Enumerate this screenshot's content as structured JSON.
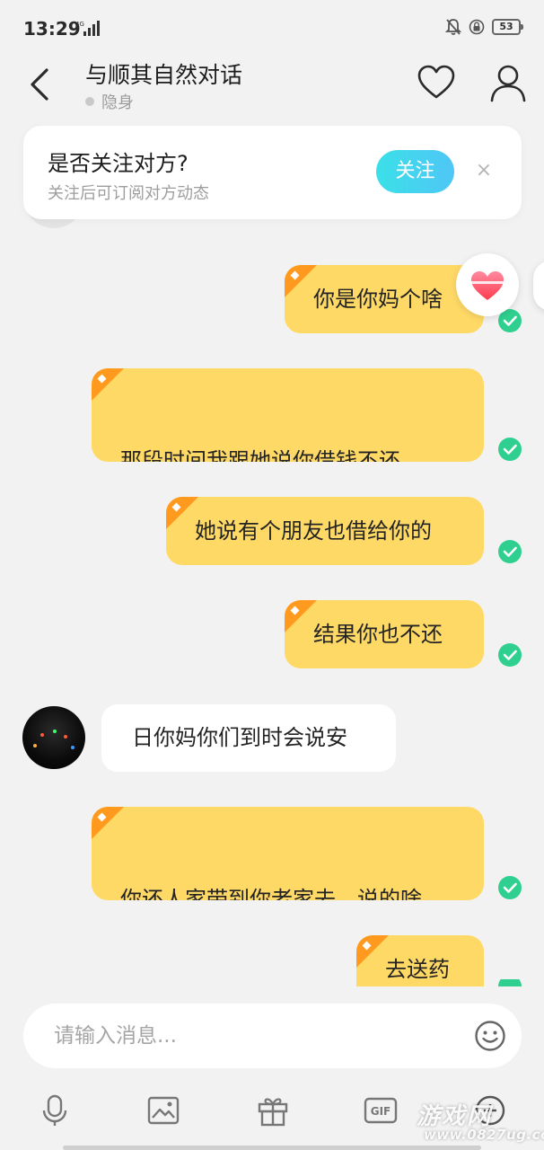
{
  "status_bar": {
    "time": "13:29",
    "network": "4G",
    "battery": "53"
  },
  "header": {
    "title": "与顺其自然对话",
    "presence": "隐身"
  },
  "follow_prompt": {
    "title": "是否关注对方?",
    "subtitle": "关注后可订阅对方动态",
    "button": "关注",
    "close": "×"
  },
  "messages": [
    {
      "side": "out",
      "text": "你是你妈个啥",
      "status": "read"
    },
    {
      "side": "out",
      "text": "那段时间我跟她说你借钱不还，\n我给她看你的陌陌号",
      "status": "read"
    },
    {
      "side": "out",
      "text": "她说有个朋友也借给你的",
      "status": "read"
    },
    {
      "side": "out",
      "text": "结果你也不还",
      "status": "read"
    },
    {
      "side": "in",
      "text": "日你妈你们到时会说安"
    },
    {
      "side": "out",
      "text": "你还人家带到你老家去，说的啥\n子",
      "status": "read"
    },
    {
      "side": "out",
      "text": "去送药",
      "status": "read"
    }
  ],
  "input": {
    "placeholder": "请输入消息..."
  },
  "toolbar": {
    "items": [
      "mic-icon",
      "image-icon",
      "gift-icon",
      "gif-icon",
      "more-icon"
    ],
    "gif_label": "GIF"
  },
  "watermark": {
    "main": "游戏网",
    "url": "www.0827ug.com"
  },
  "colors": {
    "bubble_out": "#ffd966",
    "bubble_in": "#ffffff",
    "accent": "#3fd6ee",
    "check": "#2fd08f",
    "tag": "#ff9a1f"
  }
}
